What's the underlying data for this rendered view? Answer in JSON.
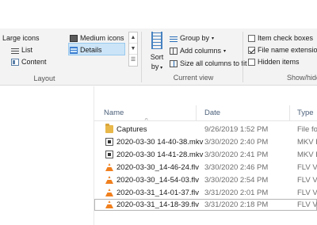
{
  "ribbon": {
    "layout": {
      "items": [
        {
          "label": "Large icons",
          "icon": "large-icons-icon"
        },
        {
          "label": "Medium icons",
          "icon": "medium-icons-icon"
        },
        {
          "label": "List",
          "icon": "list-icon"
        },
        {
          "label": "Details",
          "icon": "details-icon"
        },
        {
          "label": "Content",
          "icon": "content-icon"
        }
      ],
      "selected": "Details",
      "group_label": "Layout"
    },
    "current_view": {
      "sort_by_label": "Sort by",
      "sort_by_line1": "Sort",
      "sort_by_line2": "by",
      "group_by": "Group by",
      "add_columns": "Add columns",
      "size_all_columns": "Size all columns to fit",
      "group_label": "Current view"
    },
    "show_hide": {
      "item_check_boxes": {
        "label": "Item check boxes",
        "checked": false
      },
      "file_name_extensions": {
        "label": "File name extensions",
        "checked": true
      },
      "hidden_items": {
        "label": "Hidden items",
        "checked": false
      },
      "group_label": "Show/hide"
    }
  },
  "file_list": {
    "columns": [
      "Name",
      "Date",
      "Type"
    ],
    "rows": [
      {
        "name": "Captures",
        "date": "9/26/2019 1:52 PM",
        "type": "File fo",
        "icon": "folder-icon"
      },
      {
        "name": "2020-03-30 14-40-38.mkv",
        "date": "3/30/2020 2:40 PM",
        "type": "MKV F",
        "icon": "mkv-file-icon"
      },
      {
        "name": "2020-03-30 14-41-28.mkv",
        "date": "3/30/2020 2:41 PM",
        "type": "MKV F",
        "icon": "mkv-file-icon"
      },
      {
        "name": "2020-03-30_14-46-24.flv",
        "date": "3/30/2020 2:46 PM",
        "type": "FLV Vi",
        "icon": "vlc-icon"
      },
      {
        "name": "2020-03-30_14-54-03.flv",
        "date": "3/30/2020 2:54 PM",
        "type": "FLV Vi",
        "icon": "vlc-icon"
      },
      {
        "name": "2020-03-31_14-01-37.flv",
        "date": "3/31/2020 2:01 PM",
        "type": "FLV Vi",
        "icon": "vlc-icon"
      },
      {
        "name": "2020-03-31_14-18-39.flv",
        "date": "3/31/2020 2:18 PM",
        "type": "FLV Vi",
        "icon": "vlc-icon"
      }
    ],
    "selected_index": 6
  }
}
